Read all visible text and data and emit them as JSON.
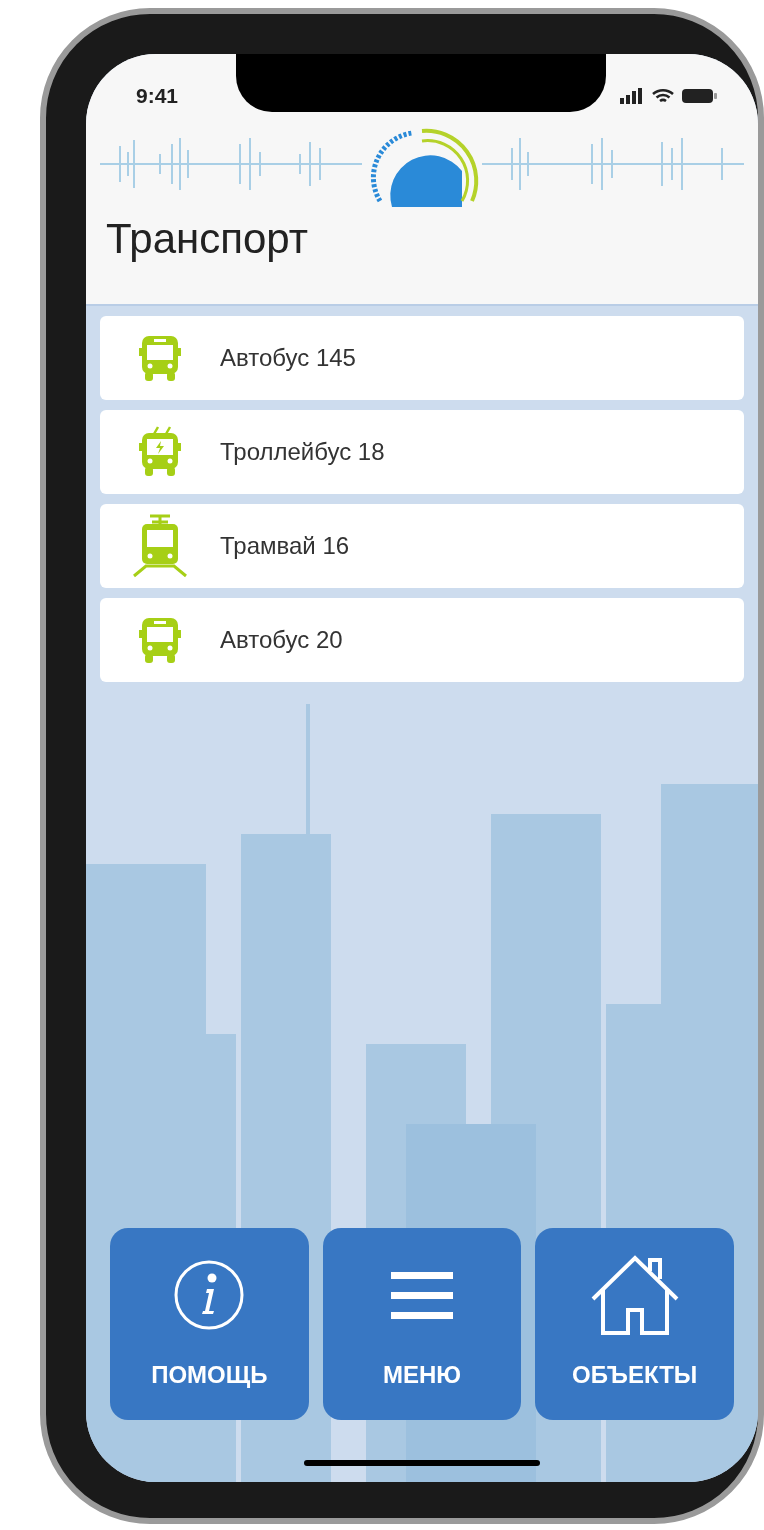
{
  "status_bar": {
    "time": "9:41"
  },
  "header": {
    "title": "Транспорт"
  },
  "routes": [
    {
      "kind": "bus",
      "label": "Автобус 145"
    },
    {
      "kind": "trolleybus",
      "label": "Троллейбус 18"
    },
    {
      "kind": "tram",
      "label": "Трамвай 16"
    },
    {
      "kind": "bus",
      "label": "Автобус 20"
    }
  ],
  "bottom_buttons": [
    {
      "kind": "info",
      "label": "ПОМОЩЬ"
    },
    {
      "kind": "menu",
      "label": "МЕНЮ"
    },
    {
      "kind": "home",
      "label": "ОБЪЕКТЫ"
    }
  ]
}
